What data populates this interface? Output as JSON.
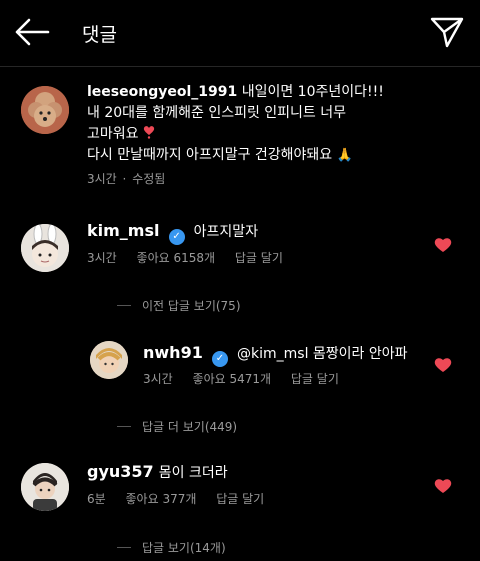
{
  "header": {
    "title": "댓글"
  },
  "post": {
    "username": "leeseongyeol_1991",
    "text1": "내일이면 10주년이다!!!",
    "line2": "내 20대를 함께해준 인스피릿 인피니트 너무",
    "line3": "고마워요",
    "line4": "다시 만날때까지 아프지말구 건강해야돼요",
    "time": "3시간",
    "edited": "수정됨",
    "sep": "·"
  },
  "comments": [
    {
      "username": "kim_msl",
      "text": "아프지말자",
      "time": "3시간",
      "likes": "좋아요 6158개",
      "reply": "답글 달기",
      "replies_link": "이전 답글 보기(75)"
    },
    {
      "username": "nwh91",
      "text": "@kim_msl 몸짱이라 안아파",
      "time": "3시간",
      "likes": "좋아요 5471개",
      "reply": "답글 달기",
      "replies_link": "답글 더 보기(449)"
    },
    {
      "username": "gyu357",
      "text": "몸이 크더라",
      "time": "6분",
      "likes": "좋아요 377개",
      "reply": "답글 달기",
      "replies_link": "답글 보기(14개)"
    }
  ],
  "icons": {
    "back": "back-arrow-icon",
    "send": "send-icon",
    "heart": "heart-icon",
    "verified": "verified-badge-icon"
  },
  "colors": {
    "background": "#000000",
    "heart": "#ed4956",
    "verified": "#3897f0",
    "muted": "#9a9a9a"
  }
}
